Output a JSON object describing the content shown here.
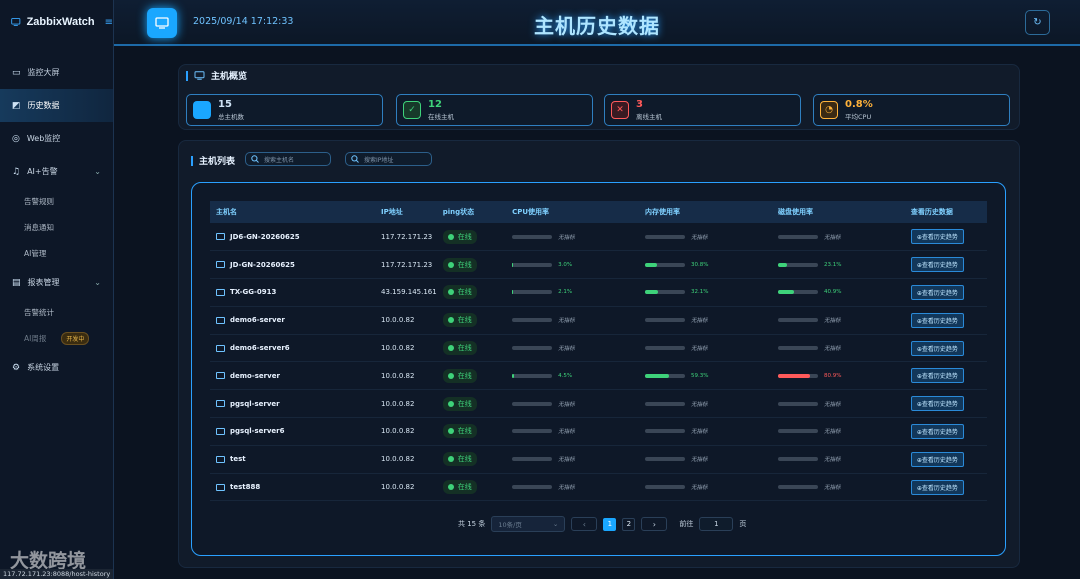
{
  "app": {
    "name": "ZabbixWatch",
    "time": "2025/09/14 17:12:33",
    "page_title": "主机历史数据"
  },
  "sidebar": {
    "items": [
      {
        "label": "监控大屏",
        "icon": "monitor-icon"
      },
      {
        "label": "历史数据",
        "icon": "chart-icon",
        "active": true
      },
      {
        "label": "Web监控",
        "icon": "globe-icon"
      },
      {
        "label": "AI+告警",
        "icon": "bell-icon",
        "expandable": true
      },
      {
        "label": "告警规则",
        "sub": true
      },
      {
        "label": "消息通知",
        "sub": true
      },
      {
        "label": "AI管理",
        "sub": true
      },
      {
        "label": "报表管理",
        "icon": "report-icon",
        "expandable": true
      },
      {
        "label": "告警统计",
        "sub": true
      },
      {
        "label": "AI周报",
        "sub": true,
        "badge": "开发中"
      },
      {
        "label": "系统设置",
        "icon": "gear-icon"
      }
    ]
  },
  "overview": {
    "title": "主机概览",
    "cards": [
      {
        "value": "15",
        "label": "总主机数",
        "color": "#e8f4ff"
      },
      {
        "value": "12",
        "label": "在线主机",
        "color": "#3ed27a"
      },
      {
        "value": "3",
        "label": "离线主机",
        "color": "#ff5a5a"
      },
      {
        "value": "0.8%",
        "label": "平均CPU",
        "color": "#ffb23a"
      }
    ]
  },
  "list": {
    "title": "主机列表",
    "search_host_placeholder": "搜索主机名",
    "search_ip_placeholder": "搜索IP地址",
    "columns": [
      "主机名",
      "IP地址",
      "ping状态",
      "CPU使用率",
      "内存使用率",
      "磁盘使用率",
      "查看历史数据"
    ],
    "ping_online": "在线",
    "no_metric": "无指标",
    "history_btn": "⊕查看历史趋势",
    "rows": [
      {
        "name": "JD6-GN-20260625",
        "ip": "117.72.171.23",
        "cpu": null,
        "mem": null,
        "disk": null
      },
      {
        "name": "JD-GN-20260625",
        "ip": "117.72.171.23",
        "cpu": 3.0,
        "mem": 30.8,
        "disk": 23.1
      },
      {
        "name": "TX-GG-0913",
        "ip": "43.159.145.161",
        "cpu": 2.1,
        "mem": 32.1,
        "disk": 40.9
      },
      {
        "name": "demo6-server",
        "ip": "10.0.0.82",
        "cpu": null,
        "mem": null,
        "disk": null
      },
      {
        "name": "demo6-server6",
        "ip": "10.0.0.82",
        "cpu": null,
        "mem": null,
        "disk": null
      },
      {
        "name": "demo-server",
        "ip": "10.0.0.82",
        "cpu": 4.5,
        "mem": 59.3,
        "disk": 80.9
      },
      {
        "name": "pgsql-server",
        "ip": "10.0.0.82",
        "cpu": null,
        "mem": null,
        "disk": null
      },
      {
        "name": "pgsql-server6",
        "ip": "10.0.0.82",
        "cpu": null,
        "mem": null,
        "disk": null
      },
      {
        "name": "test",
        "ip": "10.0.0.82",
        "cpu": null,
        "mem": null,
        "disk": null
      },
      {
        "name": "test888",
        "ip": "10.0.0.82",
        "cpu": null,
        "mem": null,
        "disk": null
      }
    ]
  },
  "pagination": {
    "total": "共 15 条",
    "page_size": "10条/页",
    "pages": [
      "1",
      "2"
    ],
    "current": "1",
    "goto_label": "前往",
    "goto_value": "1",
    "page_unit": "页"
  },
  "status_url": "117.72.171.23:8088/host-history",
  "watermark": "大数跨境"
}
